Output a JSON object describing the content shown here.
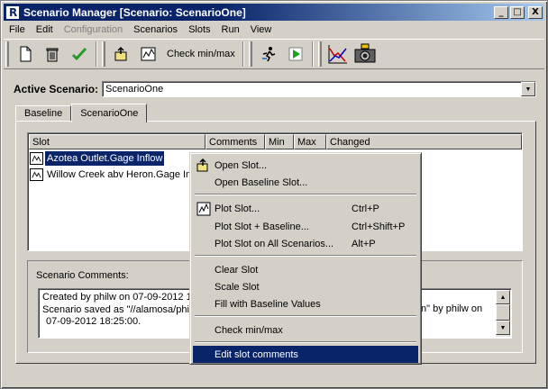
{
  "window": {
    "title": "Scenario Manager [Scenario: ScenarioOne]",
    "app_icon": "R",
    "controls": {
      "minimize": "_",
      "maximize": "□",
      "close": "X"
    }
  },
  "menubar": [
    "File",
    "Edit",
    "Configuration",
    "Scenarios",
    "Slots",
    "Run",
    "View"
  ],
  "toolbar": {
    "check_minmax_label": "Check min/max",
    "icons": [
      "new-document-icon",
      "trash-icon",
      "checkmark-icon",
      "open-slot-icon",
      "plot-icon",
      "run-figure-icon",
      "play-icon",
      "chart-icon",
      "camera-icon"
    ]
  },
  "active_scenario": {
    "label": "Active Scenario:",
    "value": "ScenarioOne"
  },
  "tabs": [
    "Baseline",
    "ScenarioOne"
  ],
  "table": {
    "columns": [
      "Slot",
      "Comments",
      "Min",
      "Max",
      "Changed"
    ],
    "rows": [
      {
        "slot": "Azotea Outlet.Gage Inflow",
        "selected": true
      },
      {
        "slot": "Willow Creek abv Heron.Gage Infl",
        "selected": false
      }
    ]
  },
  "comments": {
    "label": "Scenario Comments:",
    "line1": "Created by philw on 07-09-2012 1",
    "line2": "Scenario saved as \"//alamosa/phil",
    "line2_right": "n\" by philw on",
    "line3": "07-09-2012 18:25:00."
  },
  "context_menu": {
    "items": [
      {
        "label": "Open Slot...",
        "shortcut": "",
        "icon": "open-slot-icon"
      },
      {
        "label": "Open Baseline Slot...",
        "shortcut": "",
        "icon": ""
      },
      {
        "label": "Plot Slot...",
        "shortcut": "Ctrl+P",
        "icon": "plot-icon"
      },
      {
        "label": "Plot Slot + Baseline...",
        "shortcut": "Ctrl+Shift+P",
        "icon": ""
      },
      {
        "label": "Plot Slot  on All Scenarios...",
        "shortcut": "Alt+P",
        "icon": ""
      },
      {
        "label": "Clear Slot",
        "shortcut": "",
        "icon": ""
      },
      {
        "label": "Scale Slot",
        "shortcut": "",
        "icon": ""
      },
      {
        "label": "Fill with Baseline Values",
        "shortcut": "",
        "icon": ""
      },
      {
        "label": "Check min/max",
        "shortcut": "",
        "icon": ""
      },
      {
        "label": "Edit slot comments",
        "shortcut": "",
        "icon": ""
      }
    ],
    "highlighted": "Edit slot comments"
  },
  "colors": {
    "selection": "#0a246a",
    "face": "#d4d0c8",
    "title_gradient_end": "#a6caf0"
  }
}
